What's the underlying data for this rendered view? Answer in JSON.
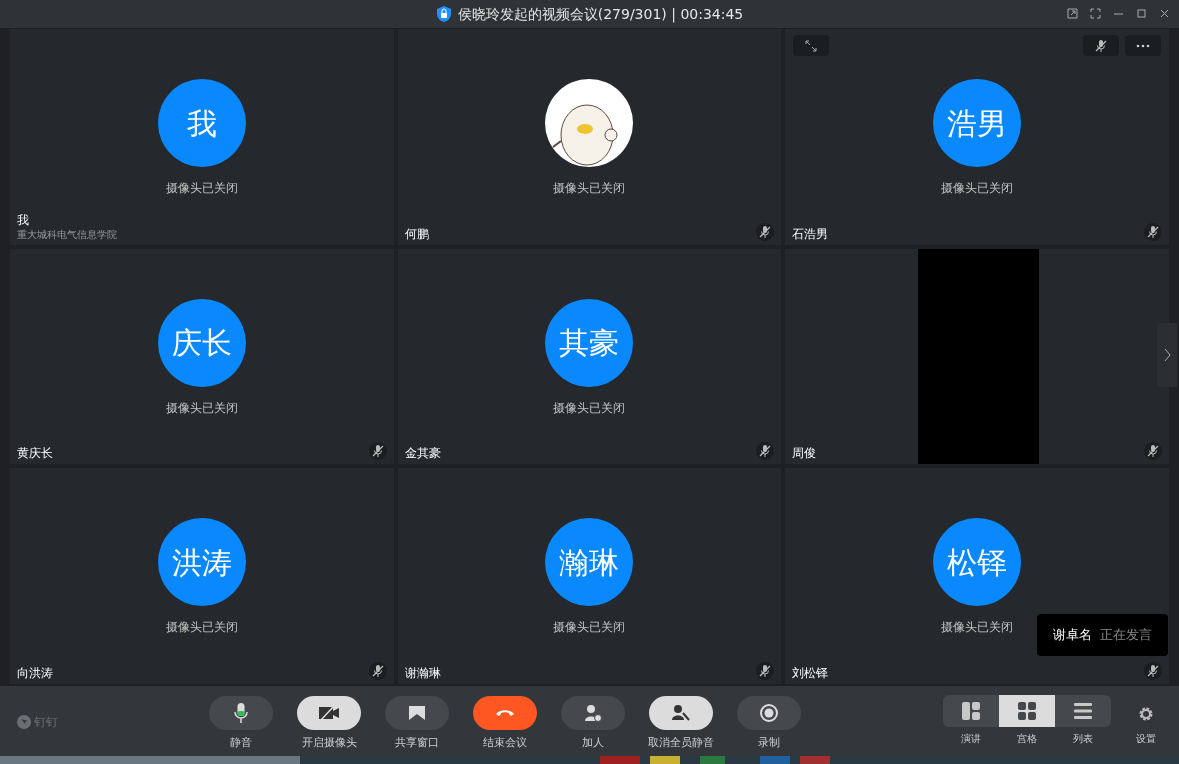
{
  "window": {
    "title": "侯晓玲发起的视频会议(279/301) | 00:34:45"
  },
  "tiles": [
    {
      "kind": "initials",
      "avatar": "我",
      "status": "摄像头已关闭",
      "name": "我",
      "subtitle": "重大城科电气信息学院",
      "muted": false,
      "hover_controls": false
    },
    {
      "kind": "picture",
      "status": "摄像头已关闭",
      "name": "何鹏",
      "muted": true,
      "hover_controls": false
    },
    {
      "kind": "initials",
      "avatar": "浩男",
      "status": "摄像头已关闭",
      "name": "石浩男",
      "muted": true,
      "hover_controls": true
    },
    {
      "kind": "initials",
      "avatar": "庆长",
      "status": "摄像头已关闭",
      "name": "黄庆长",
      "muted": true,
      "hover_controls": false
    },
    {
      "kind": "initials",
      "avatar": "其豪",
      "status": "摄像头已关闭",
      "name": "金其豪",
      "muted": true,
      "hover_controls": false
    },
    {
      "kind": "video",
      "name": "周俊",
      "muted": true,
      "hover_controls": false
    },
    {
      "kind": "initials",
      "avatar": "洪涛",
      "status": "摄像头已关闭",
      "name": "向洪涛",
      "muted": true,
      "hover_controls": false
    },
    {
      "kind": "initials",
      "avatar": "瀚琳",
      "status": "摄像头已关闭",
      "name": "谢瀚琳",
      "muted": true,
      "hover_controls": false
    },
    {
      "kind": "initials",
      "avatar": "松铎",
      "status": "摄像头已关闭",
      "name": "刘松铎",
      "muted": true,
      "hover_controls": false
    }
  ],
  "speaker_toast": {
    "name": "谢卓名",
    "status": "正在发言"
  },
  "brand": "钉钉",
  "toolbar": [
    {
      "kind": "mic",
      "label": "静音"
    },
    {
      "kind": "camera",
      "label": "开启摄像头"
    },
    {
      "kind": "share",
      "label": "共享窗口"
    },
    {
      "kind": "hangup",
      "label": "结束会议"
    },
    {
      "kind": "add",
      "label": "加人"
    },
    {
      "kind": "unmute_all",
      "label": "取消全员静音"
    },
    {
      "kind": "record",
      "label": "录制"
    }
  ],
  "views": [
    {
      "kind": "speaker",
      "label": "演讲",
      "selected": false
    },
    {
      "kind": "grid",
      "label": "宫格",
      "selected": true
    },
    {
      "kind": "list",
      "label": "列表",
      "selected": false
    }
  ],
  "settings": {
    "label": "设置"
  }
}
